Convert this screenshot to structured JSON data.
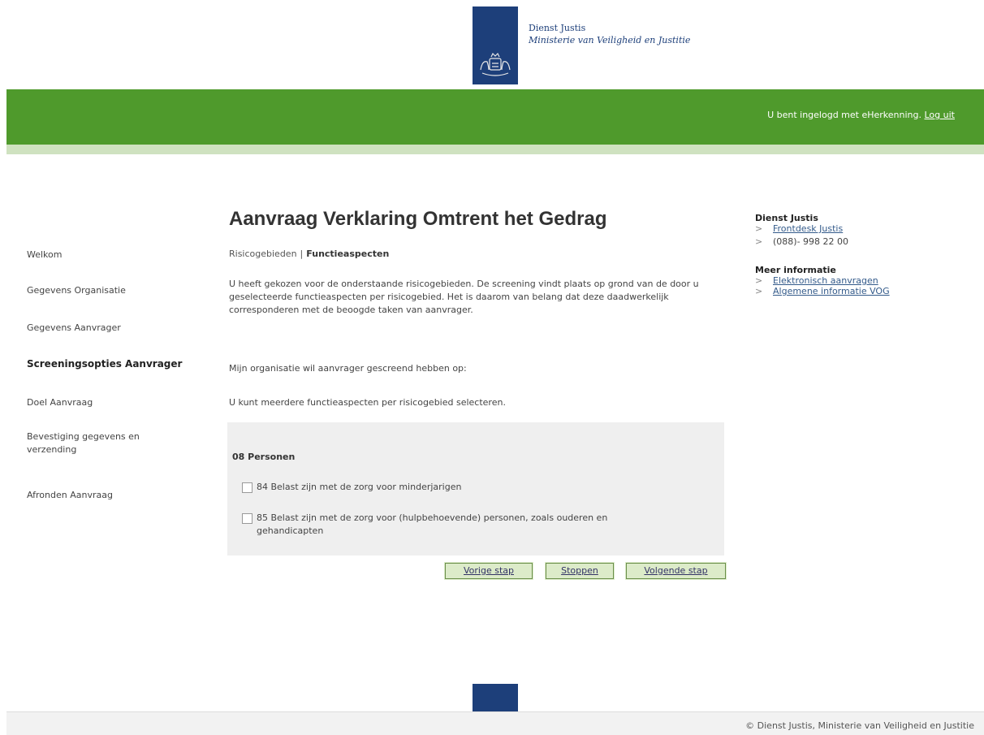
{
  "header": {
    "org_name": "Dienst Justis",
    "org_sub": "Ministerie van Veiligheid en Justitie",
    "login_text": "U bent ingelogd met eHerkenning.",
    "logout_label": "Log uit"
  },
  "sidebar": {
    "items": [
      {
        "label": "Welkom"
      },
      {
        "label": "Gegevens Organisatie"
      },
      {
        "label": "Gegevens Aanvrager"
      },
      {
        "label": "Screeningsopties Aanvrager"
      },
      {
        "label": "Doel Aanvraag"
      },
      {
        "label": "Bevestiging gegevens en verzending"
      },
      {
        "label": "Afronden Aanvraag"
      }
    ]
  },
  "main": {
    "title": "Aanvraag Verklaring Omtrent het Gedrag",
    "breadcrumb": {
      "first": "Risicogebieden",
      "separator": "|",
      "current": "Functieaspecten"
    },
    "intro": "U heeft gekozen voor de onderstaande risicogebieden. De screening vindt plaats op grond van de door u geselecteerde functieaspecten per risicogebied. Het is daarom van belang dat deze daadwerkelijk corresponderen met de beoogde taken van aanvrager.",
    "screening_text": "Mijn organisatie wil aanvrager gescreend hebben op:",
    "multi_text": "U kunt meerdere functieaspecten per risicogebied selecteren.",
    "section_heading": "08 Personen",
    "options": [
      {
        "label": "84 Belast zijn met de zorg voor minderjarigen",
        "checked": false
      },
      {
        "label": "85 Belast zijn met de zorg voor (hulpbehoevende) personen, zoals ouderen en gehandicapten",
        "checked": false
      }
    ],
    "buttons": {
      "prev": "Vorige stap",
      "stop": "Stoppen",
      "next": "Volgende stap"
    }
  },
  "aside": {
    "contact_heading": "Dienst Justis",
    "frontdesk_link": "Frontdesk Justis",
    "phone": "(088)- 998 22 00",
    "info_heading": "Meer informatie",
    "info_links": [
      "Elektronisch aanvragen",
      "Algemene informatie VOG"
    ]
  },
  "footer": {
    "copyright": "© Dienst Justis, Ministerie van Veiligheid en Justitie"
  },
  "colors": {
    "green_bar": "#4f9a2c",
    "logo_blue": "#1d3f7a",
    "button_bg": "#dcebc9",
    "link": "#335a8a"
  }
}
